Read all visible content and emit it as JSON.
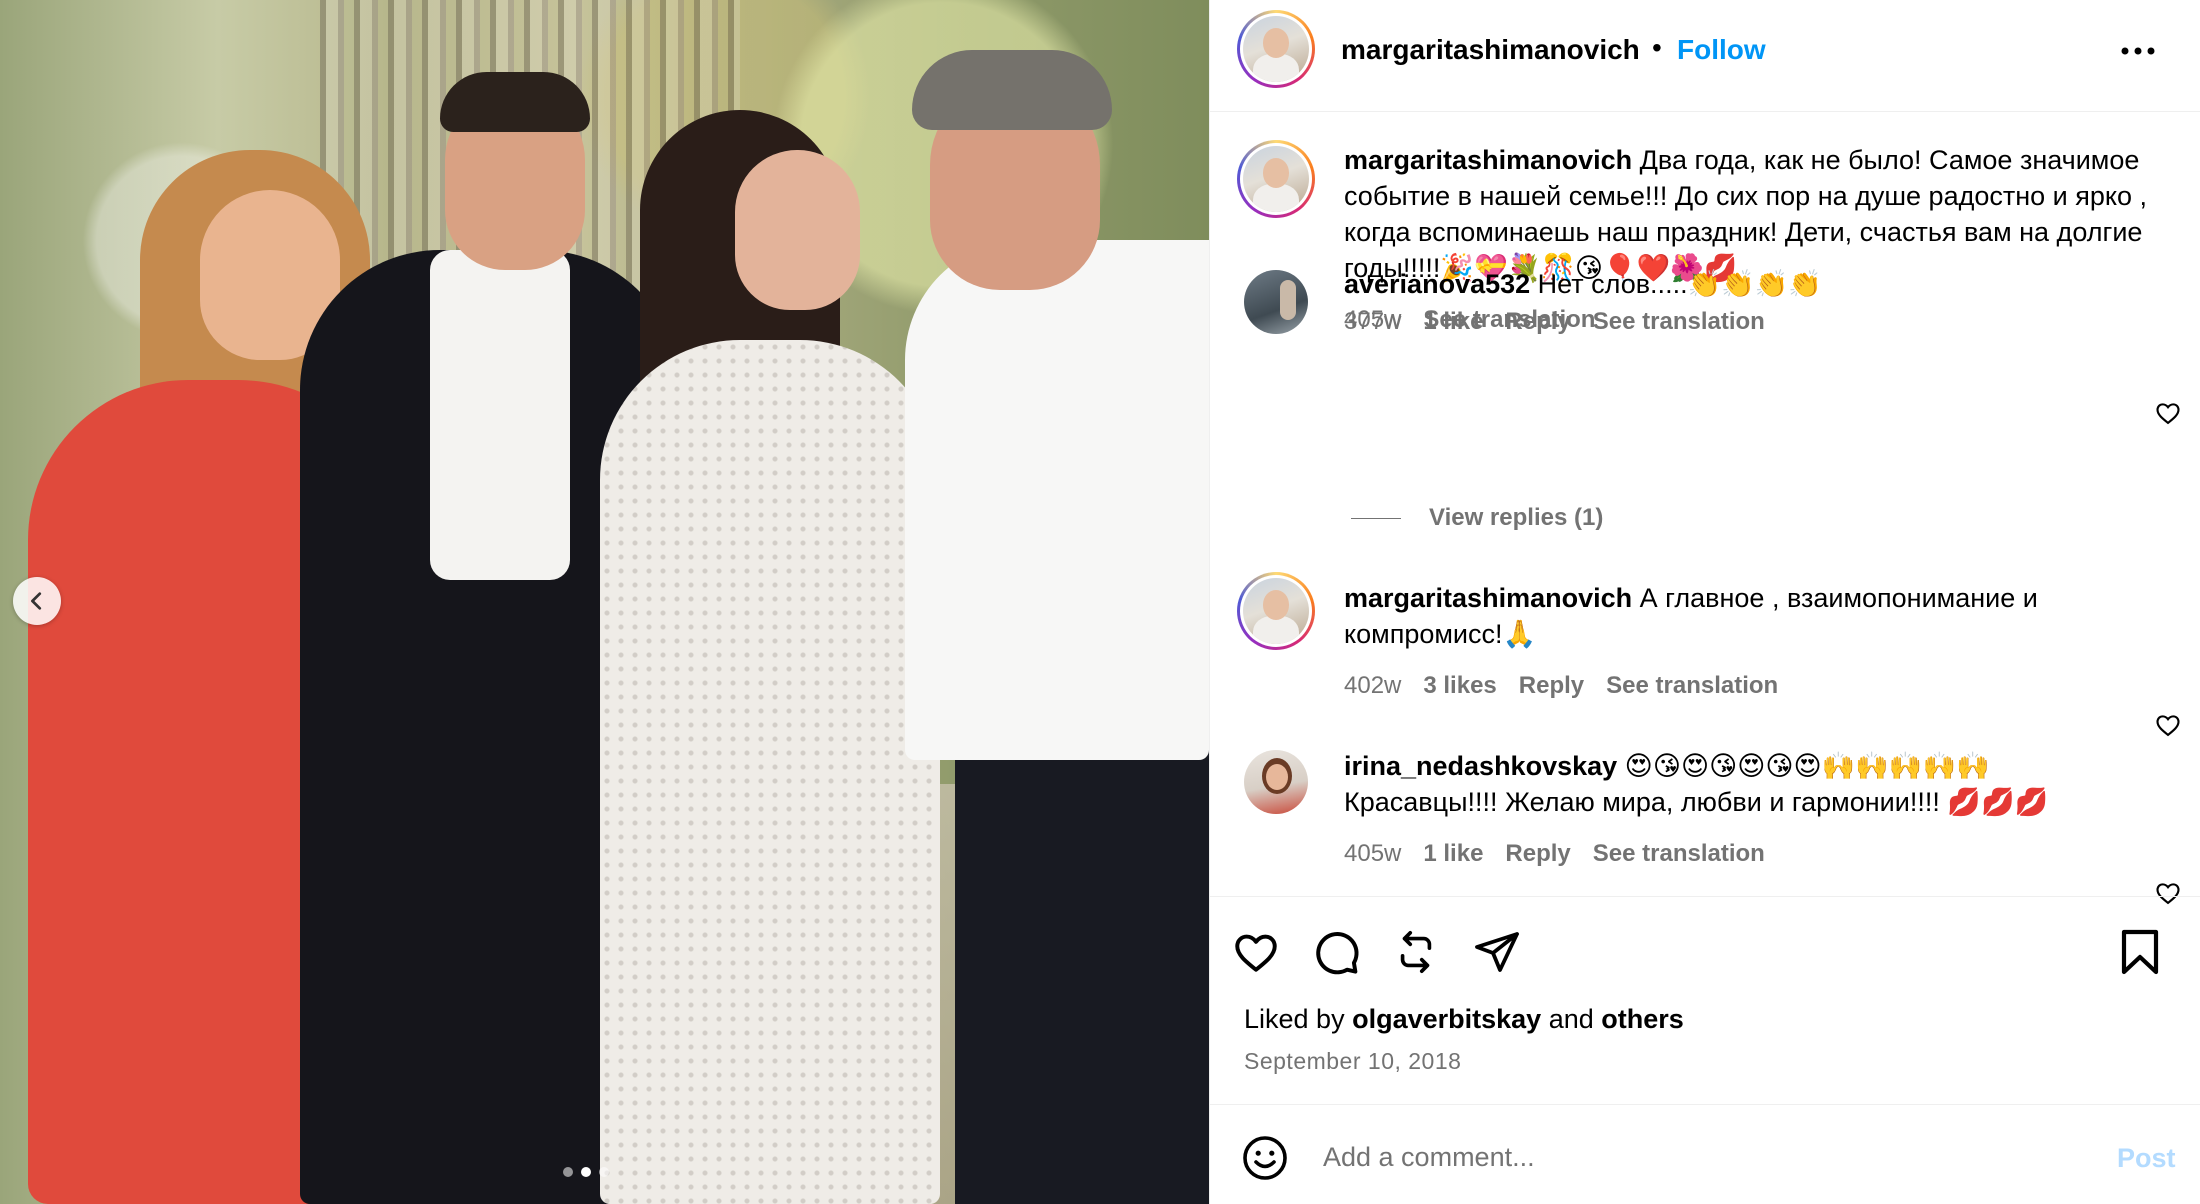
{
  "post": {
    "author": "margaritashimanovich",
    "separator": "•",
    "follow_label": "Follow",
    "more_icon": "more-horizontal-icon"
  },
  "caption": {
    "author": "margaritashimanovich",
    "text": "Два года, как не было! Самое значимое событие в нашей семье!!! До сих пор на душе радостно и ярко , когда вспоминаешь наш праздник! Дети, счастья вам на долгие годы!!!!!🎉💝💐🎊😘🎈❤️🌺💋",
    "time": "405w",
    "translate": "See translation"
  },
  "comments": [
    {
      "author": "averianova532",
      "text": "Нет слов.....👏👏👏👏",
      "time": "377w",
      "likes": "1 like",
      "reply": "Reply",
      "translate": "See translation"
    },
    {
      "author": "margaritashimanovich",
      "text": "А главное , взаимопонимание и компромисс!🙏",
      "time": "402w",
      "likes": "3 likes",
      "reply": "Reply",
      "translate": "See translation"
    },
    {
      "author": "irina_nedashkovskay",
      "text": "😍😘😍😘😍😘😍🙌🙌🙌🙌🙌 Красавцы!!!! Желаю мира, любви и гармонии!!!! 💋💋💋",
      "time": "405w",
      "likes": "1 like",
      "reply": "Reply",
      "translate": "See translation"
    }
  ],
  "view_replies": "View replies (1)",
  "likes": {
    "prefix": "Liked by",
    "user": "olgaverbitskay",
    "middle": "and",
    "others": "others"
  },
  "date": "September 10, 2018",
  "add_comment": {
    "placeholder": "Add a comment...",
    "post_label": "Post"
  },
  "carousel": {
    "prev_icon": "chevron-left-icon",
    "slide_count": 3,
    "active_slide": 1
  },
  "colors": {
    "accent": "#0095f6",
    "muted": "#737373",
    "post_disabled": "#b3dbff",
    "divider": "#efefef"
  }
}
